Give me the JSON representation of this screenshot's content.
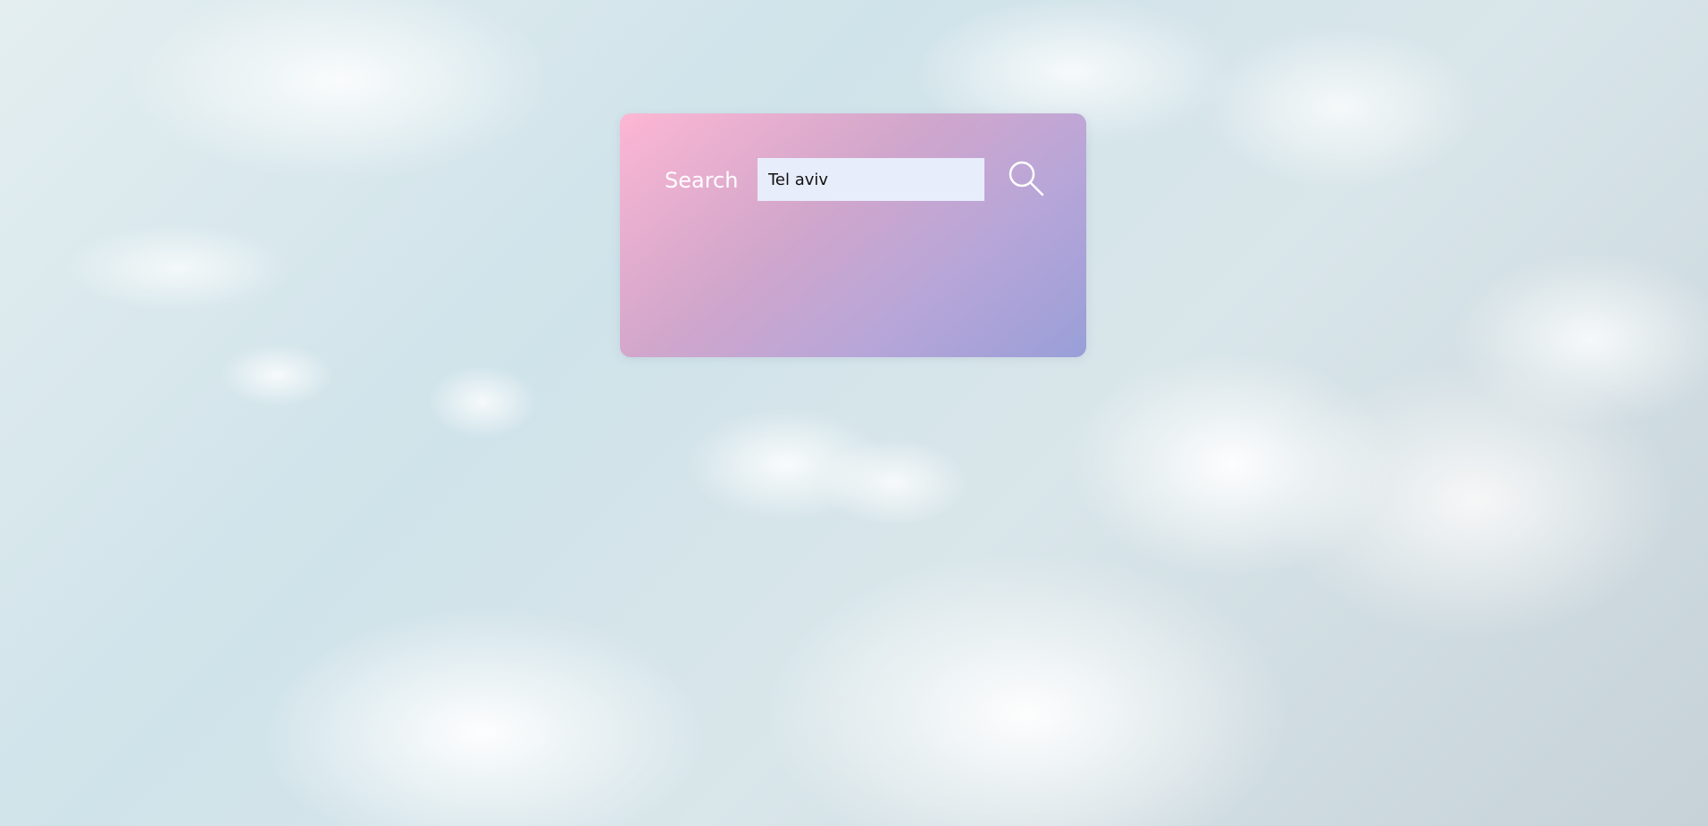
{
  "page": {
    "background": "sky-clouds"
  },
  "search": {
    "label": "Search",
    "value": "Tel aviv",
    "button_icon": "search-icon"
  },
  "colors": {
    "card_gradient_start": "#ffb4d2",
    "card_gradient_end": "#969bd7",
    "input_background": "#e8edfb",
    "label_color": "#ffffff"
  }
}
